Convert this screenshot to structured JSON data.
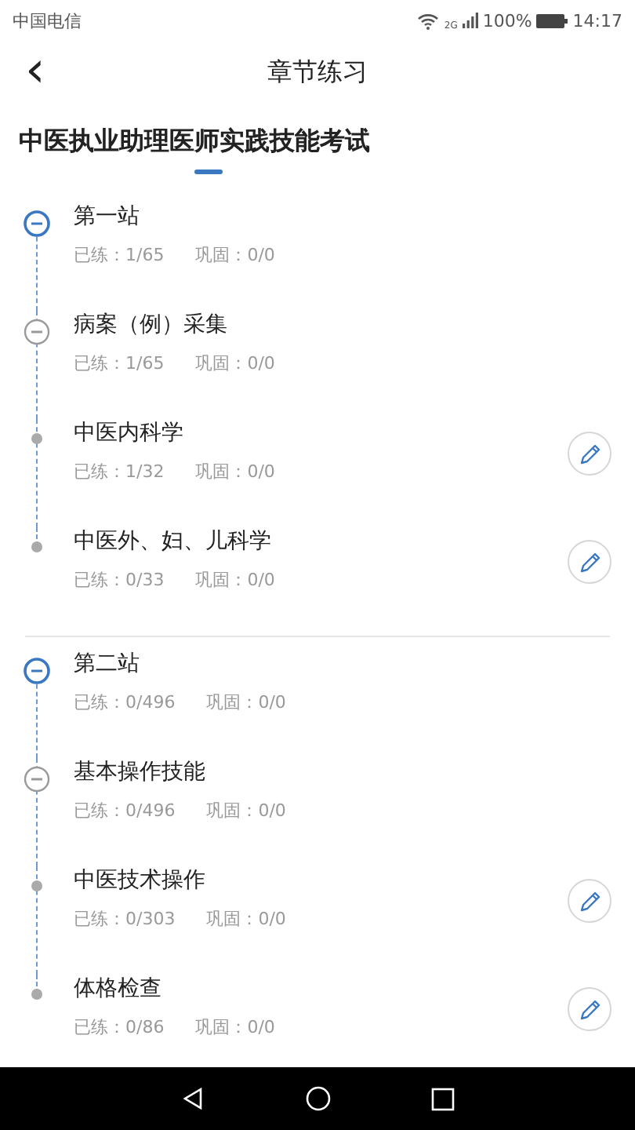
{
  "status_bar": {
    "carrier": "中国电信",
    "network": "2G",
    "battery": "100%",
    "time": "14:17"
  },
  "header": {
    "back": "‹",
    "title": "章节练习"
  },
  "exam": {
    "title": "中医执业助理医师实践技能考试"
  },
  "sections": [
    {
      "title": "第一站",
      "practiced": "已练：1/65",
      "consolidated": "巩固：0/0",
      "expanded": true,
      "children": [
        {
          "title": "病案（例）采集",
          "practiced": "已练：1/65",
          "consolidated": "巩固：0/0",
          "expanded": true,
          "children": [
            {
              "title": "中医内科学",
              "practiced": "已练：1/32",
              "consolidated": "巩固：0/0"
            },
            {
              "title": "中医外、妇、儿科学",
              "practiced": "已练：0/33",
              "consolidated": "巩固：0/0"
            }
          ]
        }
      ]
    },
    {
      "title": "第二站",
      "practiced": "已练：0/496",
      "consolidated": "巩固：0/0",
      "expanded": true,
      "children": [
        {
          "title": "基本操作技能",
          "practiced": "已练：0/496",
          "consolidated": "巩固：0/0",
          "expanded": true,
          "children": [
            {
              "title": "中医技术操作",
              "practiced": "已练：0/303",
              "consolidated": "巩固：0/0"
            },
            {
              "title": "体格检查",
              "practiced": "已练：0/86",
              "consolidated": "巩固：0/0"
            }
          ]
        }
      ]
    }
  ]
}
